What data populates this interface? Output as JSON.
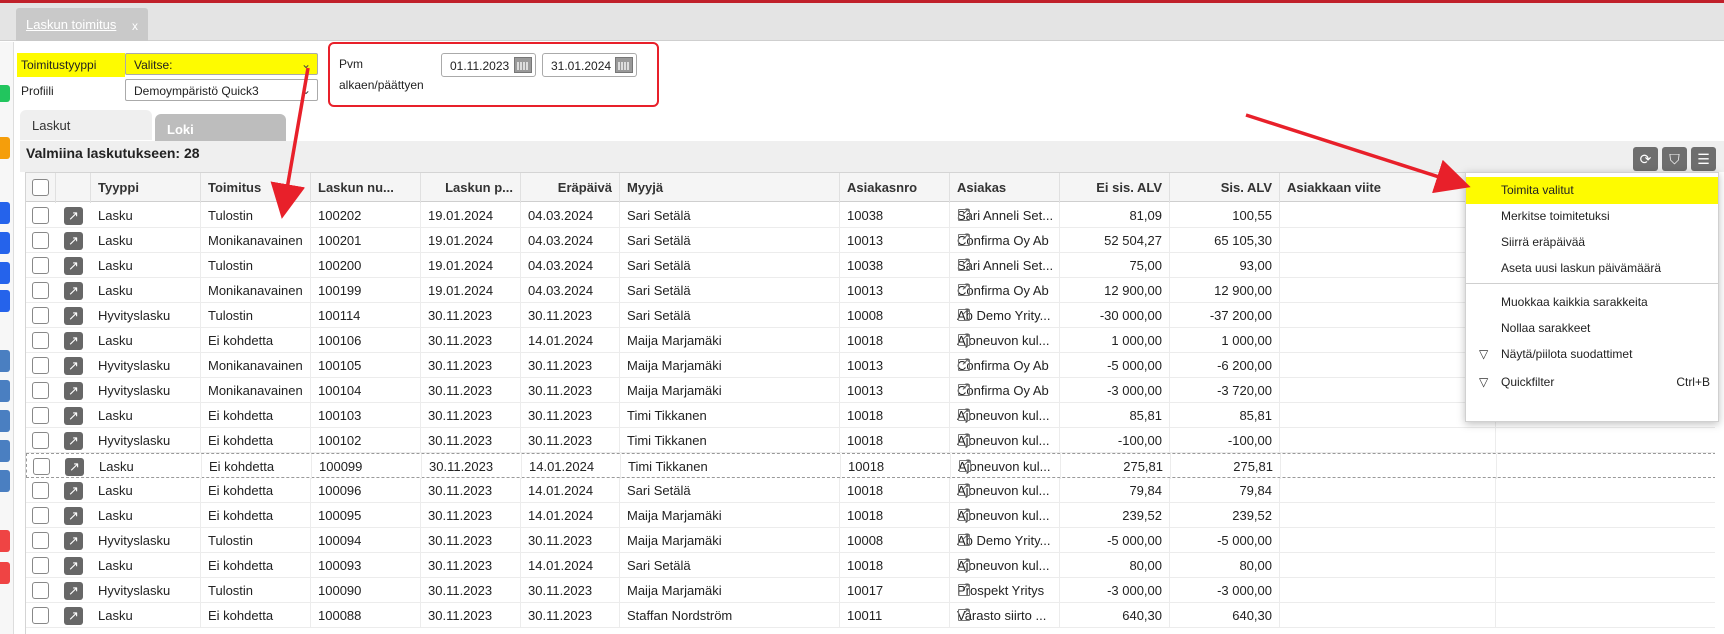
{
  "window": {
    "tab_label": "Laskun toimitus",
    "tab_close": "x"
  },
  "filters": {
    "delivery_type_label": "Toimitustyyppi",
    "delivery_type_value": "Valitse:",
    "profile_label": "Profiili",
    "profile_value": "Demoympäristö Quick3",
    "date_label_1": "Pvm",
    "date_label_2": "alkaen/päättyen",
    "date_from": "01.11.2023",
    "date_to": "31.01.2024"
  },
  "subtabs": {
    "invoices": "Laskut",
    "log": "Loki"
  },
  "summary": "Valmiina laskutukseen: 28",
  "toolbar": {
    "refresh_icon": "refresh-icon",
    "filter_icon": "filter-icon",
    "menu_icon": "hamburger-icon"
  },
  "columns": [
    "Tyyppi",
    "Toimitus",
    "Laskun nu...",
    "Laskun p...",
    "Eräpäivä",
    "Myyjä",
    "Asiakasnro",
    "Asiakas",
    "Ei sis. ALV",
    "Sis. ALV",
    "Asiakkaan viite"
  ],
  "rows": [
    [
      "Lasku",
      "Tulostin",
      "100202",
      "19.01.2024",
      "04.03.2024",
      "Sari Setälä",
      "10038",
      "Sari Anneli Set...",
      "81,09",
      "100,55"
    ],
    [
      "Lasku",
      "Monikanavainen",
      "100201",
      "19.01.2024",
      "04.03.2024",
      "Sari Setälä",
      "10013",
      "Confirma Oy Ab",
      "52 504,27",
      "65 105,30"
    ],
    [
      "Lasku",
      "Tulostin",
      "100200",
      "19.01.2024",
      "04.03.2024",
      "Sari Setälä",
      "10038",
      "Sari Anneli Set...",
      "75,00",
      "93,00"
    ],
    [
      "Lasku",
      "Monikanavainen",
      "100199",
      "19.01.2024",
      "04.03.2024",
      "Sari Setälä",
      "10013",
      "Confirma Oy Ab",
      "12 900,00",
      "12 900,00"
    ],
    [
      "Hyvityslasku",
      "Tulostin",
      "100114",
      "30.11.2023",
      "30.11.2023",
      "Sari Setälä",
      "10008",
      "Ab Demo Yrity...",
      "-30 000,00",
      "-37 200,00"
    ],
    [
      "Lasku",
      "Ei kohdetta",
      "100106",
      "30.11.2023",
      "14.01.2024",
      "Maija Marjamäki",
      "10018",
      "Ajoneuvon kul...",
      "1 000,00",
      "1 000,00"
    ],
    [
      "Hyvityslasku",
      "Monikanavainen",
      "100105",
      "30.11.2023",
      "30.11.2023",
      "Maija Marjamäki",
      "10013",
      "Confirma Oy Ab",
      "-5 000,00",
      "-6 200,00"
    ],
    [
      "Hyvityslasku",
      "Monikanavainen",
      "100104",
      "30.11.2023",
      "30.11.2023",
      "Maija Marjamäki",
      "10013",
      "Confirma Oy Ab",
      "-3 000,00",
      "-3 720,00"
    ],
    [
      "Lasku",
      "Ei kohdetta",
      "100103",
      "30.11.2023",
      "30.11.2023",
      "Timi Tikkanen",
      "10018",
      "Ajoneuvon kul...",
      "85,81",
      "85,81"
    ],
    [
      "Hyvityslasku",
      "Ei kohdetta",
      "100102",
      "30.11.2023",
      "30.11.2023",
      "Timi Tikkanen",
      "10018",
      "Ajoneuvon kul...",
      "-100,00",
      "-100,00"
    ],
    [
      "Lasku",
      "Ei kohdetta",
      "100099",
      "30.11.2023",
      "14.01.2024",
      "Timi Tikkanen",
      "10018",
      "Ajoneuvon kul...",
      "275,81",
      "275,81"
    ],
    [
      "Lasku",
      "Ei kohdetta",
      "100096",
      "30.11.2023",
      "14.01.2024",
      "Sari Setälä",
      "10018",
      "Ajoneuvon kul...",
      "79,84",
      "79,84"
    ],
    [
      "Lasku",
      "Ei kohdetta",
      "100095",
      "30.11.2023",
      "14.01.2024",
      "Maija Marjamäki",
      "10018",
      "Ajoneuvon kul...",
      "239,52",
      "239,52"
    ],
    [
      "Hyvityslasku",
      "Tulostin",
      "100094",
      "30.11.2023",
      "30.11.2023",
      "Maija Marjamäki",
      "10008",
      "Ab Demo Yrity...",
      "-5 000,00",
      "-5 000,00"
    ],
    [
      "Lasku",
      "Ei kohdetta",
      "100093",
      "30.11.2023",
      "14.01.2024",
      "Sari Setälä",
      "10018",
      "Ajoneuvon kul...",
      "80,00",
      "80,00"
    ],
    [
      "Hyvityslasku",
      "Tulostin",
      "100090",
      "30.11.2023",
      "30.11.2023",
      "Maija Marjamäki",
      "10017",
      "Prospekt Yritys",
      "-3 000,00",
      "-3 000,00"
    ],
    [
      "Lasku",
      "Ei kohdetta",
      "100088",
      "30.11.2023",
      "30.11.2023",
      "Staffan Nordström",
      "10011",
      "Varasto siirto ...",
      "640,30",
      "640,30"
    ]
  ],
  "context_menu": [
    {
      "label": "Toimita valitut",
      "highlight": true
    },
    {
      "label": "Merkitse toimitetuksi"
    },
    {
      "label": "Siirrä eräpäivää"
    },
    {
      "label": "Aseta uusi laskun päivämäärä"
    },
    {
      "label": "Muokkaa kaikkia sarakkeita"
    },
    {
      "label": "Nollaa sarakkeet"
    },
    {
      "label": "Näytä/piilota suodattimet",
      "icon": "filter-icon"
    },
    {
      "label": "Quickfilter",
      "icon": "filter-icon",
      "shortcut": "Ctrl+B"
    }
  ],
  "colors": {
    "highlight": "#fefb00",
    "annotation": "#e8202a",
    "grid_button": "#676767"
  }
}
